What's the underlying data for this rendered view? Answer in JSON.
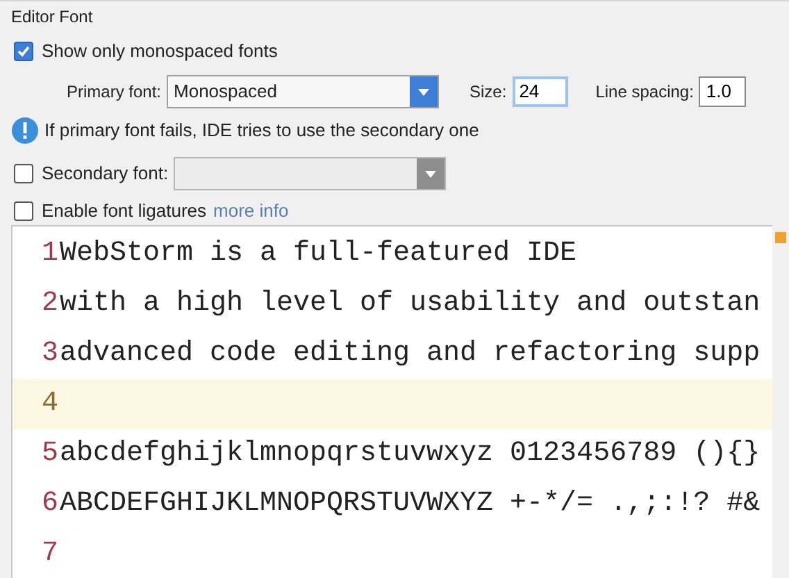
{
  "section_title": "Editor Font",
  "monospaced_only": {
    "label": "Show only monospaced fonts",
    "checked": true
  },
  "primary_font": {
    "label": "Primary font:",
    "value": "Monospaced"
  },
  "size": {
    "label": "Size:",
    "value": "24"
  },
  "line_spacing": {
    "label": "Line spacing:",
    "value": "1.0"
  },
  "info": "If primary font fails, IDE tries to use the secondary one",
  "secondary_font": {
    "label": "Secondary font:",
    "checked": false,
    "disabled": true
  },
  "ligatures": {
    "label": "Enable font ligatures",
    "checked": false,
    "link": "more info"
  },
  "preview_lines": [
    {
      "number": "1",
      "text": "WebStorm is a full-featured IDE",
      "current": false
    },
    {
      "number": "2",
      "text": "with a high level of usability and outstan",
      "current": false
    },
    {
      "number": "3",
      "text": "advanced code editing and refactoring supp",
      "current": false
    },
    {
      "number": "4",
      "current": true
    },
    {
      "number": "5",
      "text": "abcdefghijklmnopqrstuvwxyz 0123456789 (){}",
      "current": false
    },
    {
      "number": "6",
      "text": "ABCDEFGHIJKLMNOPQRSTUVWXYZ +-*/= .,;:!? #&",
      "current": false
    },
    {
      "number": "7",
      "current": false
    }
  ]
}
